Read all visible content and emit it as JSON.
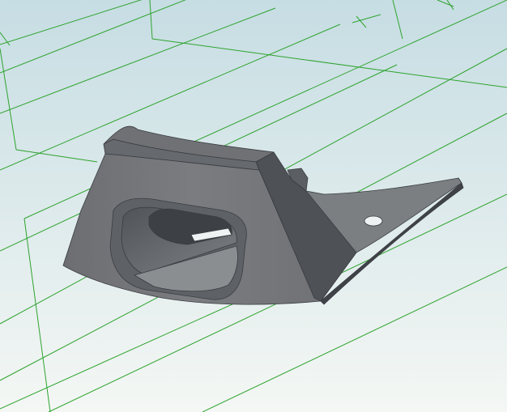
{
  "viewport": {
    "background_top": "#c6dde3",
    "background_bottom": "#f4f7f4"
  },
  "grid": {
    "color": "#2fa32f"
  },
  "model": {
    "colors": {
      "top_face": "#6f7174",
      "front_face": "#75777b",
      "side_face": "#5b5e62",
      "dark_face": "#4e5256",
      "flange_top": "#7c7f82",
      "flange_edge": "#3f4347",
      "cavity_wall": "#5e6165",
      "cavity_floor": "#8b8e91",
      "cavity_deep": "#3d4044",
      "slot": "#eef2f3",
      "edge": "#3a3d41"
    }
  }
}
